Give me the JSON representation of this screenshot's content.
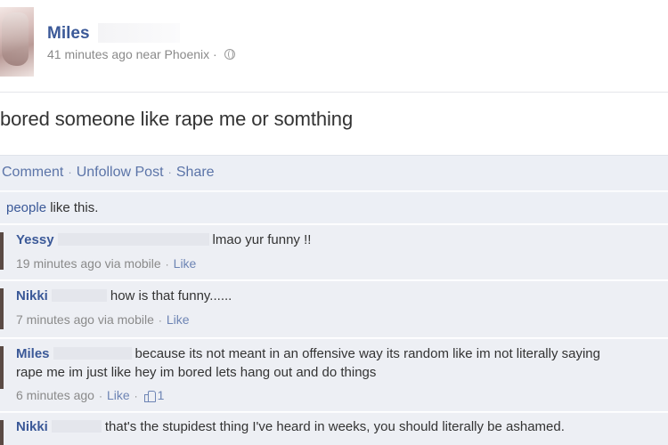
{
  "post": {
    "author": "Miles",
    "time": "41 minutes ago",
    "location": "near Phoenix",
    "meta_sep": "·",
    "privacy_icon": "globe-icon",
    "status_text": "bored someone like rape me or somthing"
  },
  "actions": {
    "comment": "Comment",
    "unfollow": "Unfollow Post",
    "share": "Share",
    "sep": "·"
  },
  "likes": {
    "people_link": "people",
    "suffix": " like this."
  },
  "comments": [
    {
      "author": "Yessy",
      "text": "lmao yur funny !!",
      "time": "19 minutes ago via mobile",
      "like": "Like"
    },
    {
      "author": "Nikki",
      "text": "how is that funny......",
      "time": "7 minutes ago via mobile",
      "like": "Like"
    },
    {
      "author": "Miles",
      "text_line1": "because its not meant in an offensive way its random like im not literally saying",
      "text_line2": "rape me im just like hey im bored lets hang out and do things",
      "time": "6 minutes ago",
      "like": "Like",
      "like_count": "1"
    },
    {
      "author": "Nikki",
      "text": "that's the stupidest thing I've heard in weeks, you should literally be ashamed."
    }
  ],
  "colors": {
    "link": "#3b5998",
    "panel": "#edeff4",
    "meta": "#8a8a8a"
  }
}
